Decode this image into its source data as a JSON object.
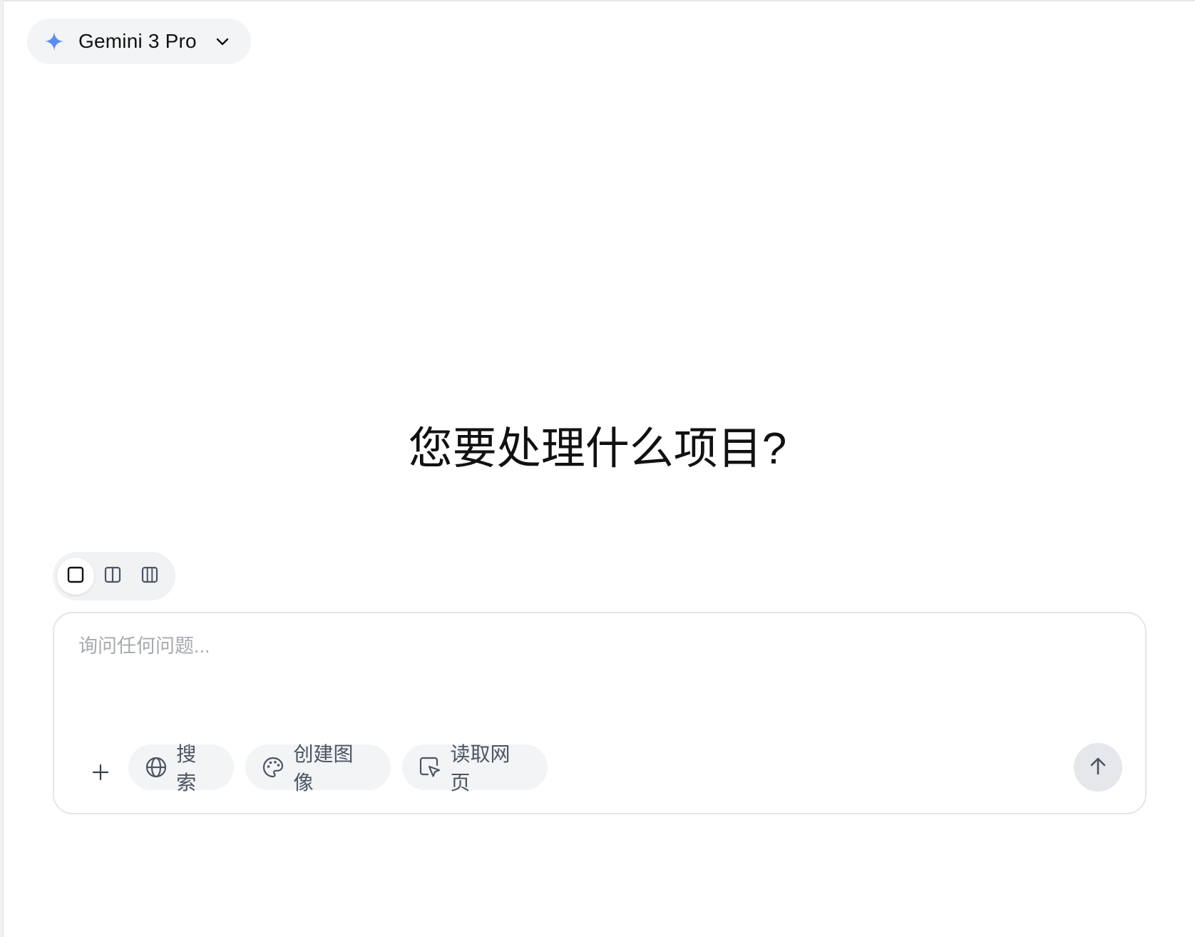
{
  "model_selector": {
    "label": "Gemini 3 Pro",
    "icon": "sparkle-icon",
    "icon_color": "#5b8def"
  },
  "heading": "您要处理什么项目?",
  "layout_switcher": {
    "options": [
      "single-pane-icon",
      "two-pane-icon",
      "three-pane-icon"
    ],
    "selected": "single-pane-icon"
  },
  "composer": {
    "placeholder": "询问任何问题...",
    "value": "",
    "tools": {
      "search_label": "搜索",
      "create_image_label": "创建图像",
      "read_page_label": "读取网页"
    }
  }
}
